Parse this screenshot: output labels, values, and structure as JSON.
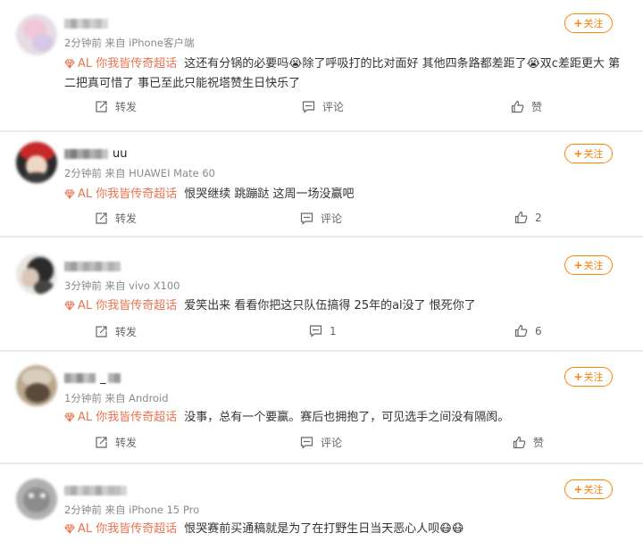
{
  "posts": [
    {
      "name_suffix": "",
      "meta": "2分钟前 来自 iPhone客户端",
      "follow_label": "关注",
      "tag_label": "AL 你我皆传奇超话",
      "text": "这还有分锅的必要吗😭除了呼吸打的比对面好 其他四条路都差距了😭双c差距更大 第二把真可惜了 事已至此只能祝塔赞生日快乐了",
      "repost_label": "转发",
      "comment_label": "评论",
      "like_label": "赞"
    },
    {
      "name_suffix": "uu",
      "meta": "2分钟前 来自 HUAWEI Mate 60",
      "follow_label": "关注",
      "tag_label": "AL 你我皆传奇超话",
      "text": "恨哭继续 跳蹦跶 这周一场没赢吧",
      "repost_label": "转发",
      "comment_label": "评论",
      "like_label": "2"
    },
    {
      "name_suffix": "",
      "meta": "3分钟前 来自 vivo X100",
      "follow_label": "关注",
      "tag_label": "AL 你我皆传奇超话",
      "text": "爱笑出来 看看你把这只队伍搞得 25年的al没了 恨死你了",
      "repost_label": "转发",
      "comment_label": "1",
      "like_label": "6"
    },
    {
      "name_suffix": "_",
      "meta": "1分钟前 来自 Android",
      "follow_label": "关注",
      "tag_label": "AL 你我皆传奇超话",
      "text": "没事，总有一个要赢。赛后也拥抱了，可见选手之间没有隔阂。",
      "repost_label": "转发",
      "comment_label": "评论",
      "like_label": "赞"
    },
    {
      "name_suffix": "",
      "meta": "2分钟前 来自 iPhone 15 Pro",
      "follow_label": "关注",
      "tag_label": "AL 你我皆传奇超话",
      "text": "恨哭赛前买通稿就是为了在打野生日当天恶心人呗😷😷",
      "repost_label": "",
      "comment_label": "",
      "like_label": ""
    }
  ],
  "colors": {
    "accent": "#ff8200",
    "tag": "#eb7350",
    "meta": "#8a8a8a",
    "background": "#e9e9e9"
  },
  "icons": [
    "plus-icon",
    "gem-icon",
    "repost-icon",
    "comment-icon",
    "like-icon"
  ]
}
